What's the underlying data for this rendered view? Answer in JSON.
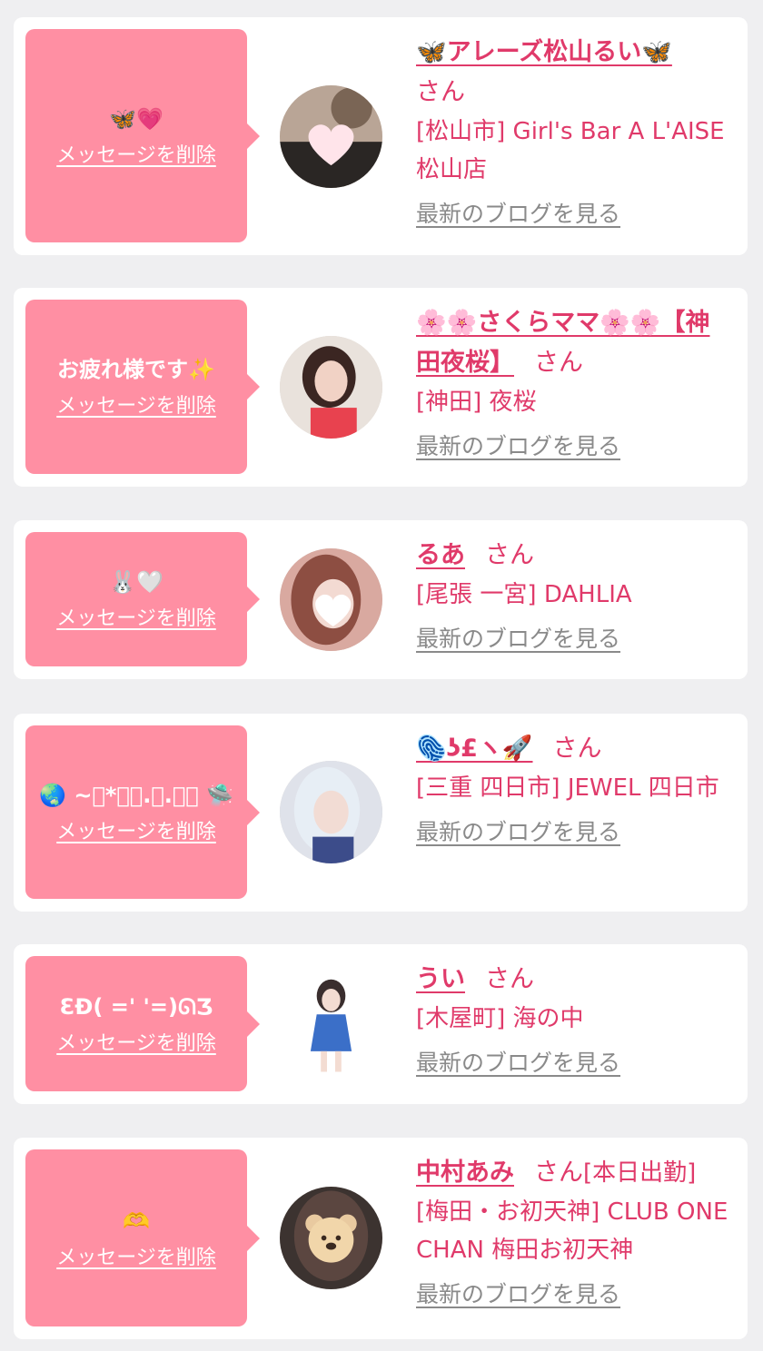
{
  "delete_label": "メッセージを削除",
  "blog_label": "最新のブログを見る",
  "honorific": "さん",
  "colors": {
    "accent": "#e03a6a",
    "bubble": "#ff8fa3",
    "link_gray": "#8a8a8a",
    "background": "#efeff1"
  },
  "items": [
    {
      "message": "🦋💗",
      "name": "🦋アレーズ松山るい🦋",
      "shop": "[松山市] Girl's Bar A L'AISE 松山店",
      "extra": ""
    },
    {
      "message": "お疲れ様です✨",
      "name": "🌸🌸さくらママ🌸🌸【神田夜桜】",
      "shop": "[神田] 夜桜",
      "extra": ""
    },
    {
      "message": "🐰🤍",
      "name": "るあ",
      "shop": "[尾張 一宮] DAHLIA",
      "extra": ""
    },
    {
      "message": "🌏 ~ﾟ*ﾟ･.｡.･ﾟ 🛸",
      "name": "🫆ʖ£ヽ🚀",
      "shop": "[三重 四日市] JEWEL 四日市",
      "extra": ""
    },
    {
      "message": "ƐÐ( ='  '=)ᘏƷ",
      "name": "うい",
      "shop": "[木屋町] 海の中",
      "extra": ""
    },
    {
      "message": "🫶",
      "name": "中村あみ",
      "shop": "[梅田・お初天神] CLUB ONE CHAN 梅田お初天神",
      "extra": "[本日出勤]"
    }
  ]
}
